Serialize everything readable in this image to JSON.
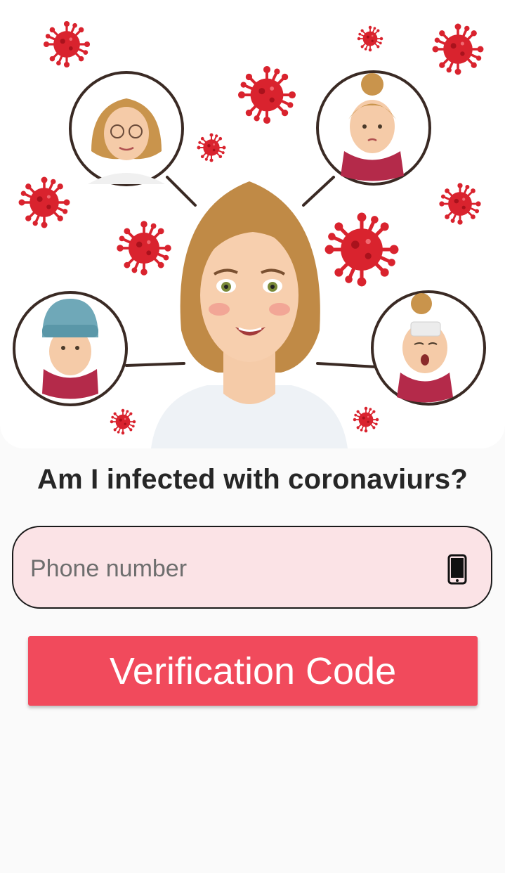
{
  "hero": {
    "image_icon": "people-infection-illustration"
  },
  "page": {
    "title": "Am I infected with coronaviurs?"
  },
  "phone": {
    "placeholder": "Phone number",
    "value": "",
    "icon": "smartphone-icon"
  },
  "actions": {
    "verify_label": "Verification Code"
  },
  "colors": {
    "background": "#fafafa",
    "input_bg": "#fbe3e6",
    "button": "#f14a5c",
    "virus": "#d9232e",
    "title": "#262626"
  }
}
